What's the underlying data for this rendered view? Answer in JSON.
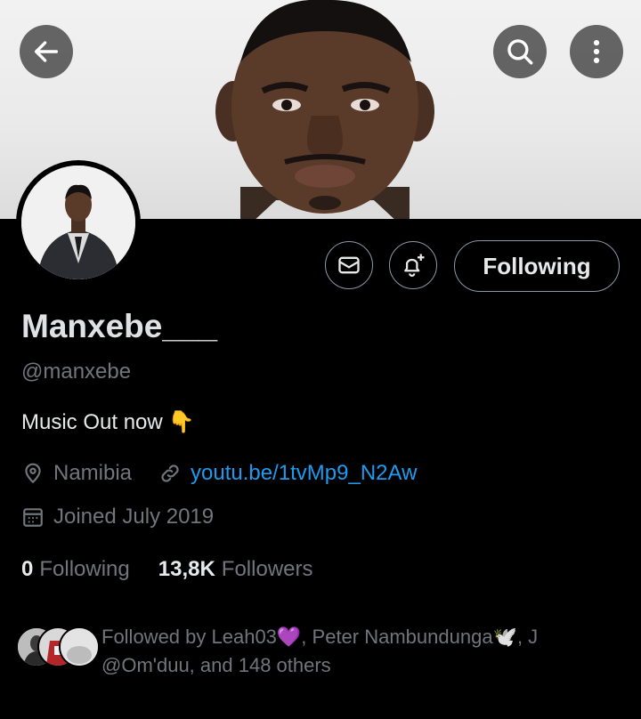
{
  "header": {
    "back_icon": "arrow-left-icon",
    "search_icon": "search-icon",
    "more_icon": "more-vertical-icon"
  },
  "profile": {
    "display_name": "Manxebe___",
    "handle": "@manxebe",
    "bio": "Music Out now",
    "bio_emoji": "👇",
    "location": "Namibia",
    "website": "youtu.be/1tvMp9_N2Aw",
    "joined": "Joined July 2019"
  },
  "actions": {
    "message_icon": "envelope-icon",
    "notify_icon": "bell-plus-icon",
    "following_label": "Following"
  },
  "stats": {
    "following_count": "0",
    "following_label": "Following",
    "followers_count": "13,8K",
    "followers_label": "Followers"
  },
  "followed_by": {
    "line1": "Followed by Leah03💜, Peter Nambundunga🕊️, J",
    "line2": "@Om'duu, and 148 others"
  },
  "colors": {
    "background": "#000000",
    "link": "#1d9bf0",
    "secondary_text": "#71767b",
    "primary_text": "#e7e9ea"
  }
}
